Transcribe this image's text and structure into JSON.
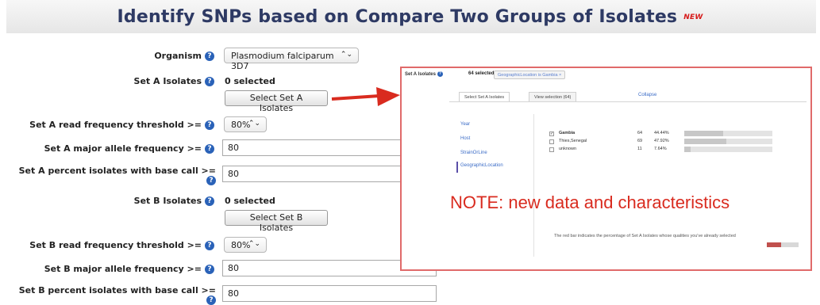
{
  "header": {
    "title": "Identify SNPs based on Compare Two Groups of Isolates",
    "new_badge": "NEW"
  },
  "form": {
    "organism_label": "Organism",
    "organism_value": "Plasmodium falciparum 3D7",
    "set_a_isolates_label": "Set A Isolates",
    "set_a_selected": "0 selected",
    "set_a_button": "Select Set A Isolates",
    "set_a_read_freq_label": "Set A read frequency threshold >=",
    "set_a_read_freq_value": "80%",
    "set_a_major_allele_label": "Set A major allele frequency >=",
    "set_a_major_allele_value": "80",
    "set_a_percent_label_1": "Set A percent isolates with base call >=",
    "set_a_percent_value": "80",
    "set_b_isolates_label": "Set B Isolates",
    "set_b_selected": "0 selected",
    "set_b_button": "Select Set B Isolates",
    "set_b_read_freq_label": "Set B read frequency threshold >=",
    "set_b_read_freq_value": "80%",
    "set_b_major_allele_label": "Set B major allele frequency >=",
    "set_b_major_allele_value": "80",
    "set_b_percent_label_1": "Set B percent isolates with base call >=",
    "set_b_percent_value": "80"
  },
  "inset": {
    "label": "Set A Isolates",
    "count": "64 selected",
    "filter_chip": "GeographicLocation is Gambia",
    "filter_chip_close": "×",
    "tab_select": "Select Set A Isolates",
    "tab_view": "View selection (64)",
    "collapse": "Collapse",
    "facets": [
      "Year",
      "Host",
      "StrainOrLine",
      "GeographicLocation"
    ],
    "rows": [
      {
        "checked": true,
        "name": "Gambia",
        "count": "64",
        "percent": "44.44%",
        "fraction": 0.4444
      },
      {
        "checked": false,
        "name": "Thies,Senegal",
        "count": "69",
        "percent": "47.92%",
        "fraction": 0.4792
      },
      {
        "checked": false,
        "name": "unknown",
        "count": "11",
        "percent": "7.64%",
        "fraction": 0.0764
      }
    ],
    "red_bar_text": "The red bar indicates the percentage of Set A Isolates whose qualities you've already selected",
    "red_bar_fraction": 0.4444,
    "colors": {
      "border": "#e06a6a",
      "link": "#3b6cc7",
      "red_bar": "#c0504d"
    }
  },
  "note": "NOTE: new data and characteristics",
  "icons": {
    "help": "help-icon",
    "arrow": "red-arrow-icon"
  }
}
